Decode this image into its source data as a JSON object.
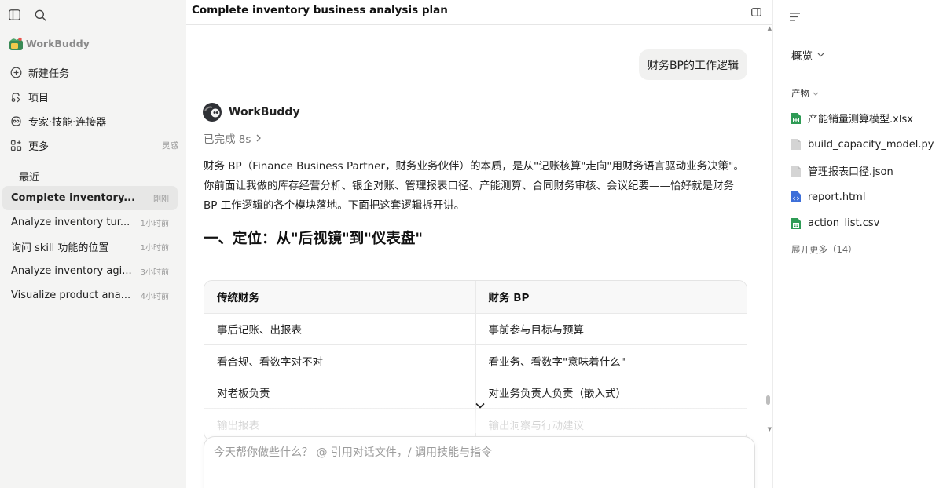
{
  "sidebar": {
    "brand": "WorkBuddy",
    "nav": [
      {
        "label": "新建任务",
        "icon": "plus-circle-icon",
        "aux": ""
      },
      {
        "label": "项目",
        "icon": "project-icon",
        "aux": ""
      },
      {
        "label": "专家·技能·连接器",
        "icon": "skills-icon",
        "aux": ""
      },
      {
        "label": "更多",
        "icon": "grid-plus-icon",
        "aux": "灵感"
      }
    ],
    "recent_title": "最近",
    "recent": [
      {
        "title": "Complete inventory...",
        "time": "刚刚",
        "active": true
      },
      {
        "title": "Analyze inventory tur...",
        "time": "1小时前"
      },
      {
        "title": "询问 skill 功能的位置",
        "time": "1小时前"
      },
      {
        "title": "Analyze inventory agi...",
        "time": "3小时前"
      },
      {
        "title": "Visualize product ana...",
        "time": "4小时前"
      }
    ]
  },
  "main": {
    "title": "Complete inventory business analysis plan",
    "user_message": "财务BP的工作逻辑",
    "agent_name": "WorkBuddy",
    "done_label": "已完成 8s",
    "answer_paragraph": "财务 BP（Finance Business Partner，财务业务伙伴）的本质，是从\"记账核算\"走向\"用财务语言驱动业务决策\"。你前面让我做的库存经营分析、银企对账、管理报表口径、产能测算、合同财务审核、会议纪要——恰好就是财务 BP 工作逻辑的各个模块落地。下面把这套逻辑拆开讲。",
    "heading": "一、定位：从\"后视镜\"到\"仪表盘\"",
    "table": {
      "headers": [
        "传统财务",
        "财务 BP"
      ],
      "rows": [
        [
          "事后记账、出报表",
          "事前参与目标与预算"
        ],
        [
          "看合规、看数字对不对",
          "看业务、看数字\"意味着什么\""
        ],
        [
          "对老板负责",
          "对业务负责人负责（嵌入式）"
        ],
        [
          "输出报表",
          "输出洞察与行动建议"
        ]
      ]
    },
    "composer_placeholder": "今天帮你做些什么？ @ 引用对话文件，/ 调用技能与指令"
  },
  "right_panel": {
    "overview_label": "概览",
    "artifacts_label": "产物",
    "files": [
      {
        "name": "产能销量测算模型.xlsx",
        "icon": "spreadsheet-icon",
        "color": "#2e9b55"
      },
      {
        "name": "build_capacity_model.py",
        "icon": "file-icon",
        "color": "#cfcfcf"
      },
      {
        "name": "管理报表口径.json",
        "icon": "file-icon",
        "color": "#cfcfcf"
      },
      {
        "name": "report.html",
        "icon": "html-file-icon",
        "color": "#3d6fd9"
      },
      {
        "name": "action_list.csv",
        "icon": "spreadsheet-icon",
        "color": "#2e9b55"
      }
    ],
    "more_label": "展开更多（14）"
  }
}
